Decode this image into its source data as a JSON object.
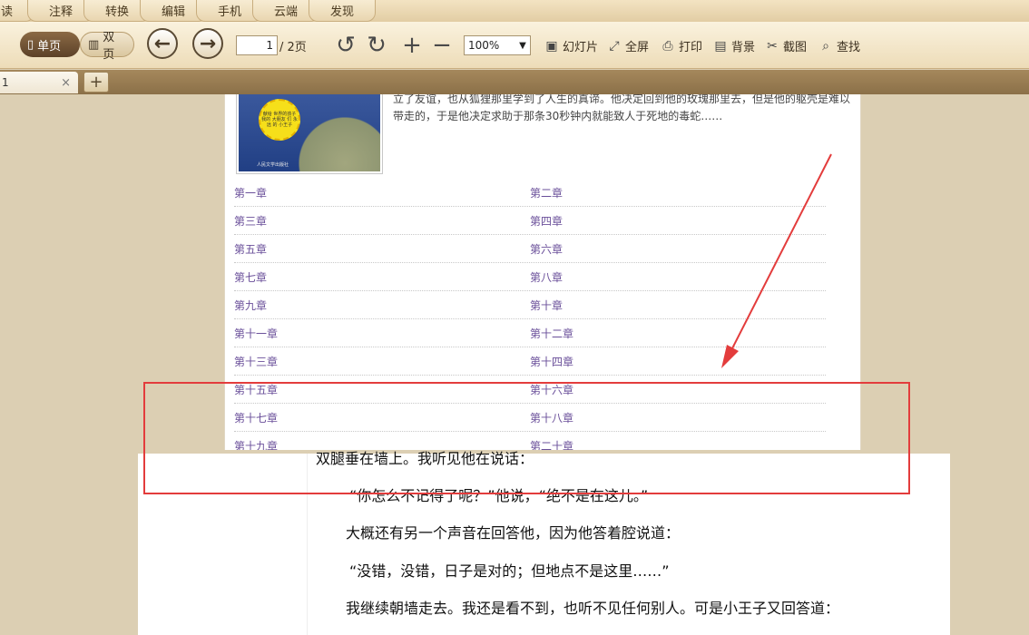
{
  "menu": [
    "阅读",
    "注释",
    "转换",
    "编辑",
    "手机",
    "云端",
    "发现"
  ],
  "toolbar": {
    "single_page": "单页",
    "double_page": "双页",
    "page_current": "1",
    "page_total": "/ 2页",
    "zoom": "100%",
    "slideshow": "幻灯片",
    "fullscreen": "全屏",
    "print": "打印",
    "background": "背景",
    "screenshot": "截图",
    "find": "查找"
  },
  "tabs": {
    "doc_tab_label": "1",
    "close_icon": "×",
    "add_icon": "+"
  },
  "book": {
    "cover_badge": "献给 世界的孩子 我的 大朋友 们 永远 的 小王子",
    "cover_publisher": "人民文学出版社",
    "synopsis": "立了友谊，也从狐狸那里学到了人生的真谛。他决定回到他的玫瑰那里去，但是他的躯壳是难以带走的，于是他决定求助于那条30秒钟内就能致人于死地的毒蛇……",
    "chapters": [
      [
        "第一章",
        "第二章"
      ],
      [
        "第三章",
        "第四章"
      ],
      [
        "第五章",
        "第六章"
      ],
      [
        "第七章",
        "第八章"
      ],
      [
        "第九章",
        "第十章"
      ],
      [
        "第十一章",
        "第十二章"
      ],
      [
        "第十三章",
        "第十四章"
      ],
      [
        "第十五章",
        "第十六章"
      ],
      [
        "第十七章",
        "第十八章"
      ],
      [
        "第十九章",
        "第二十章"
      ]
    ]
  },
  "story": {
    "line1": "双腿垂在墙上。我听见他在说话：",
    "line2": "“你怎么不记得了呢？”他说，“绝不是在这儿。”",
    "line3": "大概还有另一个声音在回答他，因为他答着腔说道：",
    "line4": "“没错，没错，日子是对的；但地点不是这里……”",
    "line5": "我继续朝墙走去。我还是看不到，也听不见任何别人。可是小王子又回答道："
  },
  "colors": {
    "annotation": "#e33c3c",
    "chapter_link": "#6a4f9a"
  }
}
